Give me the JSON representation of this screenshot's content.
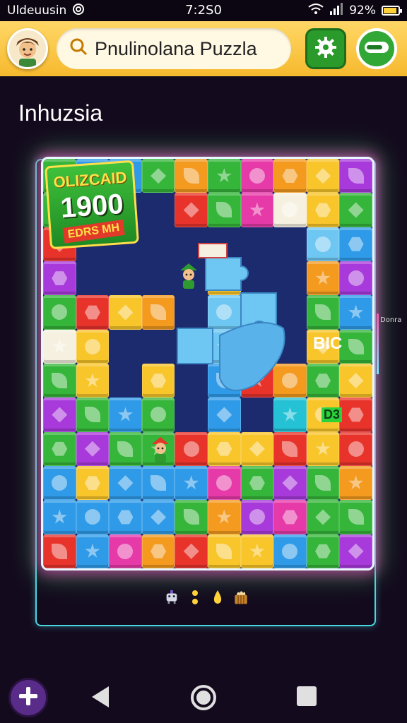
{
  "status_bar": {
    "carrier": "Uldeuusin",
    "time": "7:2S0",
    "battery": "92%",
    "battery_level": 0.92,
    "icons": [
      "at-icon",
      "wifi-icon",
      "signal-icon",
      "battery-icon"
    ]
  },
  "header": {
    "avatar_icon": "player-avatar",
    "search_text": "Pnulinolana Puzzla",
    "search_icon": "magnifier-icon",
    "settings_icon": "gear-icon",
    "toggle_icon": "toggle-icon"
  },
  "page": {
    "subtitle": "Inhuzsia",
    "side_label": "Donra"
  },
  "badge": {
    "line1": "OLIZCAID",
    "score": "1900",
    "line3": "EDRS MH"
  },
  "board": {
    "colors": {
      "R": "#e8332b",
      "O": "#f39a1f",
      "Y": "#f8c52a",
      "G": "#35b53a",
      "B": "#2f9be8",
      "L": "#6ec7f2",
      "P": "#a83adb",
      "M": "#e63aa8",
      "C": "#25c2d6",
      "W": "#f5f0e0"
    },
    "symbols": [
      "star",
      "gem",
      "circle",
      "leaf",
      "hex"
    ],
    "rows": [
      "GBBGOGMOYP",
      "G...RGMWYG",
      "R.......LB",
      "P....Y..OP",
      "GRYO.L..GB",
      "WY...L..YG",
      "GY.Y.BROGY",
      "PGBG.B.CYR",
      "GPGGRYYRYR",
      "BYBBBMGPGO",
      "BBBBGOPMGG",
      "RBMORYYBGP"
    ],
    "text_piece": "BIC",
    "text_piece2": "D3"
  },
  "tray": {
    "items": [
      "robot-icon",
      "dots-icon",
      "drop-icon",
      "basket-icon"
    ]
  },
  "nav": {
    "fab_icon": "plus-icon",
    "back_icon": "back-icon",
    "home_icon": "home-icon",
    "recent_icon": "recent-apps-icon"
  }
}
